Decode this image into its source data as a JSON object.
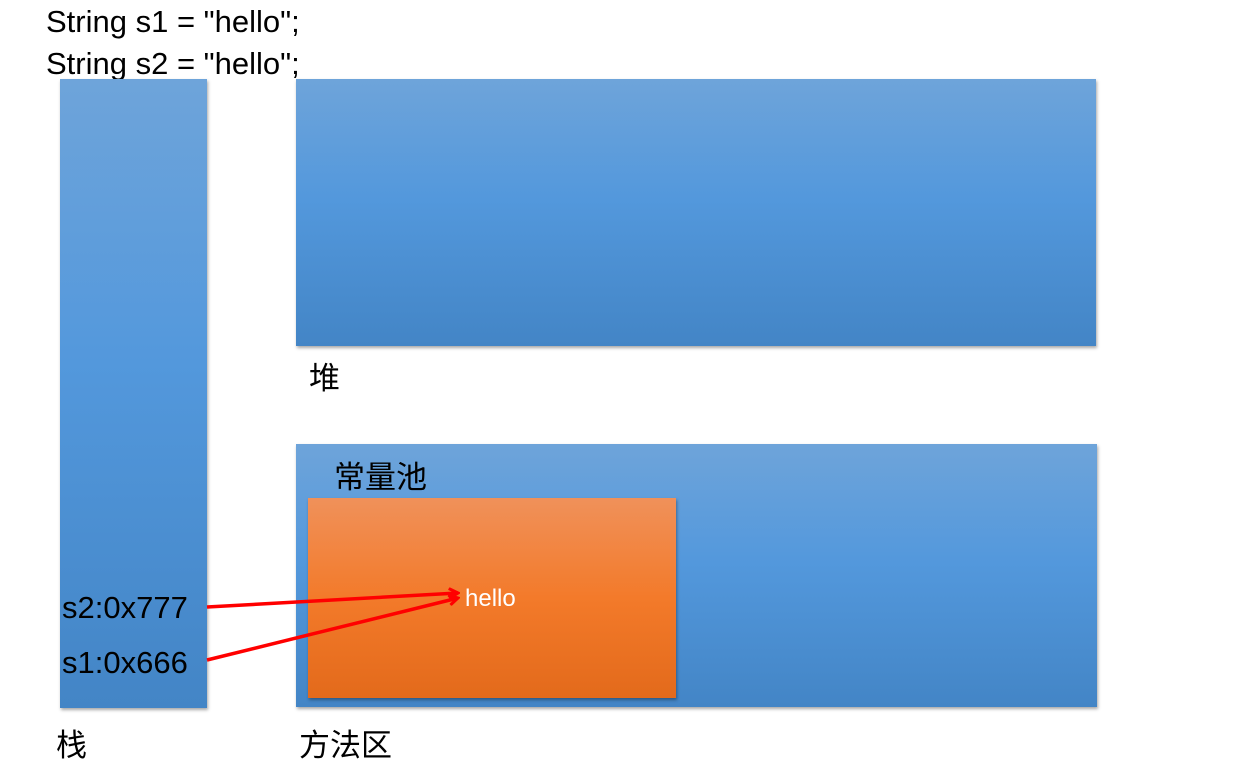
{
  "code": {
    "line1": "String s1 = \"hello\";",
    "line2": "String s2 = \"hello\";"
  },
  "regions": {
    "heap_label": "堆",
    "constant_pool_label": "常量池",
    "stack_label": "栈",
    "method_area_label": "方法区"
  },
  "stack": {
    "s2": "s2:0x777",
    "s1": "s1:0x666"
  },
  "constant_pool": {
    "value": "hello"
  },
  "colors": {
    "region_blue": "#5398dc",
    "pool_orange": "#f37a2a",
    "arrow_red": "#ff0000"
  }
}
